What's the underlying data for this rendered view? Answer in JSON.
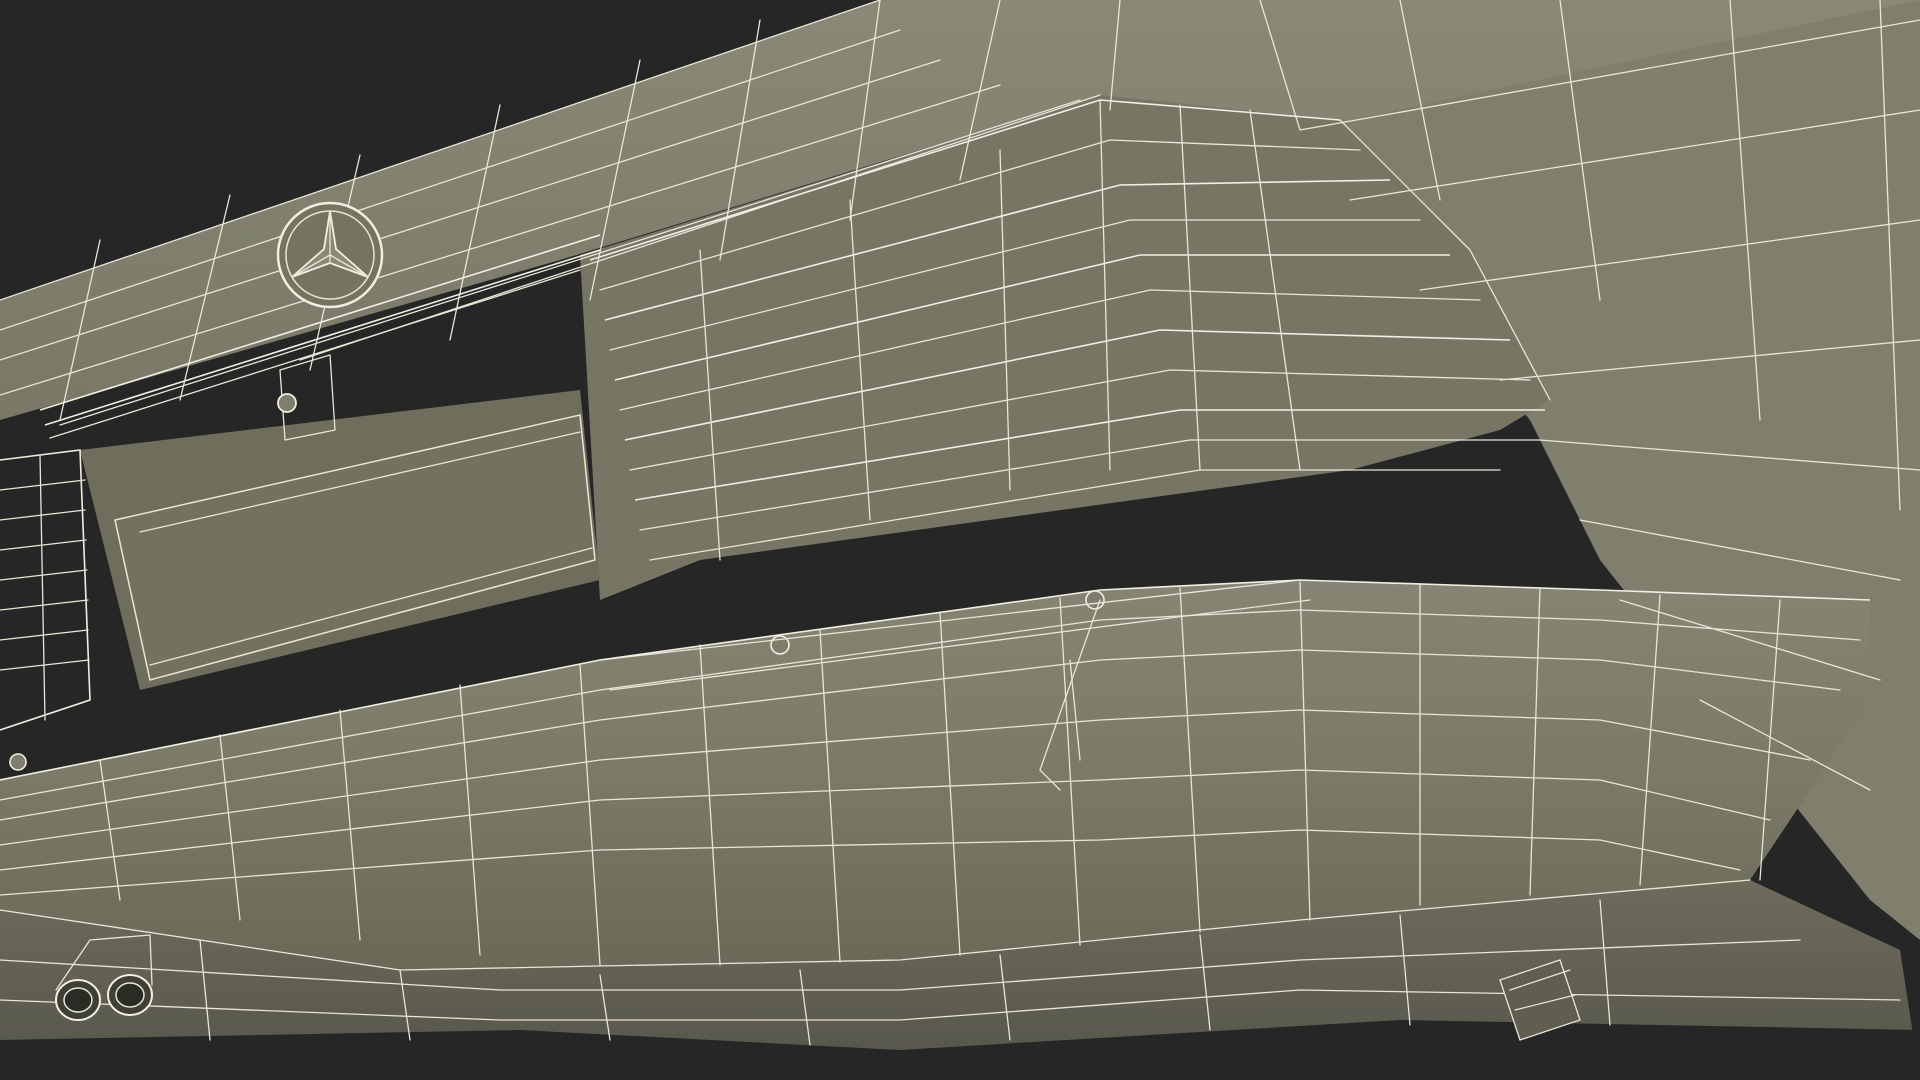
{
  "scene": {
    "subject": "",
    "render_style": "wireframe-over-shaded"
  },
  "colors": {
    "background": "#262626",
    "surface": "#7d7c6a",
    "surface_light": "#8a8977",
    "surface_dark": "#5f5e50",
    "shadow": "#4a4a3f",
    "wire": "#e8e6d6"
  },
  "icons": {
    "emblem": "three-pointed-star-emblem",
    "exhaust": "twin-exhaust-tips"
  }
}
